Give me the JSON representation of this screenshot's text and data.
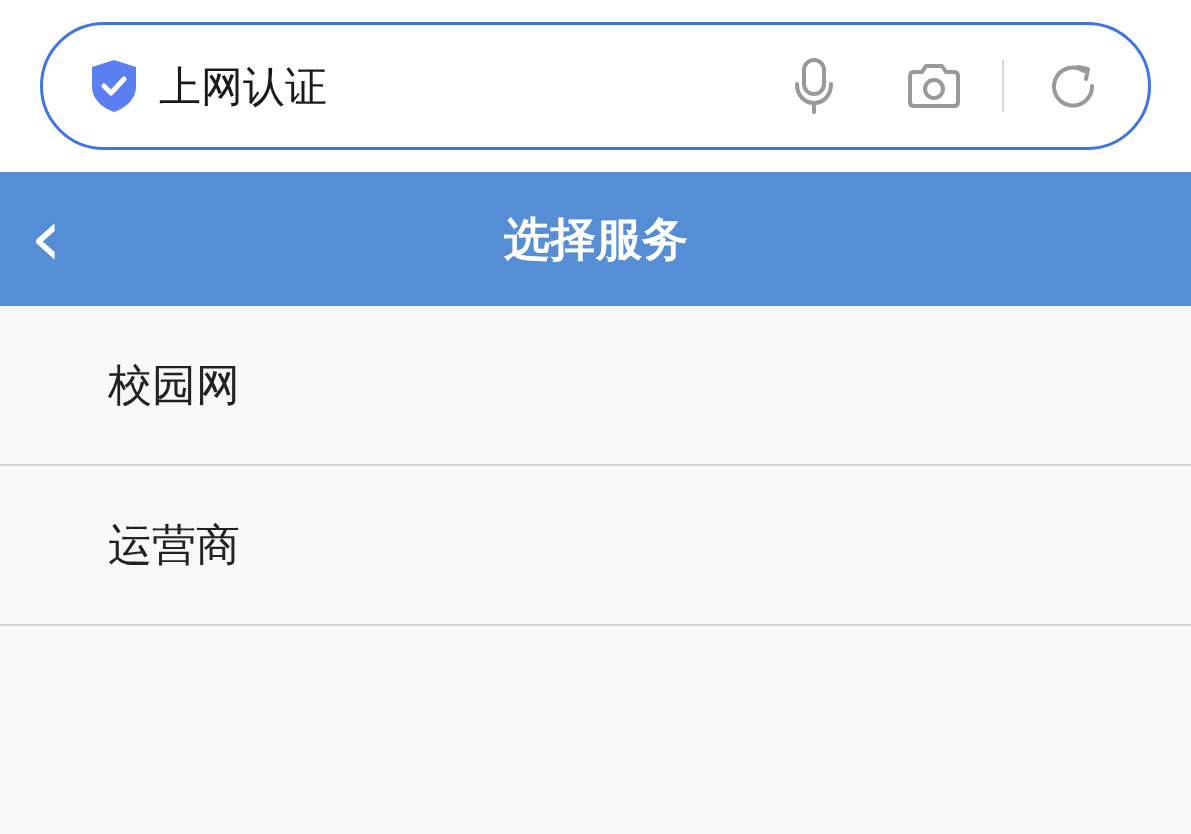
{
  "address_bar": {
    "text": "上网认证"
  },
  "header": {
    "back": "‹",
    "title": "选择服务"
  },
  "services": [
    {
      "label": "校园网"
    },
    {
      "label": "运营商"
    }
  ]
}
